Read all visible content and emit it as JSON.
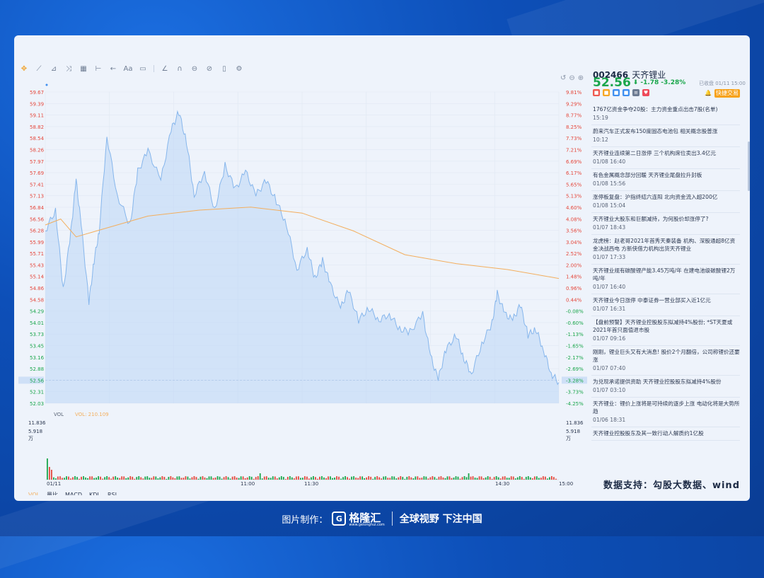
{
  "stock": {
    "code": "002466",
    "name": "天齐锂业",
    "price": "52.56",
    "change": "-1.78",
    "change_pct": "-3.28%",
    "status": "已收盘 01/11 15:00",
    "trade_button": "快捷交易"
  },
  "chart": {
    "price_ticks": [
      "59.67",
      "59.39",
      "59.11",
      "58.82",
      "58.54",
      "58.26",
      "57.97",
      "57.69",
      "57.41",
      "57.13",
      "56.84",
      "56.56",
      "56.28",
      "55.99",
      "55.71",
      "55.43",
      "55.14",
      "54.86",
      "54.58",
      "54.29",
      "54.01",
      "53.73",
      "53.45",
      "53.16",
      "52.88",
      "52.56",
      "52.31",
      "52.03"
    ],
    "pct_ticks": [
      "9.81%",
      "9.29%",
      "8.77%",
      "8.25%",
      "7.73%",
      "7.21%",
      "6.69%",
      "6.17%",
      "5.65%",
      "5.13%",
      "4.60%",
      "4.08%",
      "3.56%",
      "3.04%",
      "2.52%",
      "2.00%",
      "1.48%",
      "0.96%",
      "0.44%",
      "-0.08%",
      "-0.60%",
      "-1.13%",
      "-1.65%",
      "-2.17%",
      "-2.69%",
      "-3.28%",
      "-3.73%",
      "-4.25%"
    ],
    "time_labels": [
      "01/11",
      "11:00",
      "11:30",
      "14:30",
      "15:00"
    ],
    "vol_label": "VOL",
    "vol_value": "VOL: 210.109",
    "vol_ticks": [
      "11.836",
      "5.918",
      "万"
    ],
    "indicator_tabs": [
      "VOL",
      "量比",
      "MACD",
      "KDJ",
      "RSI"
    ],
    "colors": {
      "price_line": "#86b6ec",
      "avg_line": "#f3ae5d",
      "up": "#e5483c",
      "down": "#1aa64b",
      "area_fill": "#bcd6f6"
    }
  },
  "news": [
    {
      "title": "1767亿资金争夺20股：主力资金重点出击7股(名单)",
      "time": "15:19"
    },
    {
      "title": "蔚来汽车正式发布150度固态电池包 相关概念股普涨",
      "time": "10:12"
    },
    {
      "title": "天齐锂业连续第二日涨停 三个机构席位卖出3.4亿元",
      "time": "01/08 16:40"
    },
    {
      "title": "有色金属概念部分回暖 天齐锂业尾盘拉升封板",
      "time": "01/08 15:56"
    },
    {
      "title": "涨停板复盘：沪指终结六连阳 北向资金流入超200亿",
      "time": "01/08 15:04"
    },
    {
      "title": "天齐锂业大股东和巨额减持，为何股价却涨停了?",
      "time": "01/07 18:43"
    },
    {
      "title": "龙虎榜：赵老哥2021年首秀天秦装备 机构、深股通超8亿资金决战西电 方新侠借力机构出货天齐锂业",
      "time": "01/07 17:33"
    },
    {
      "title": "天齐锂业规有碳酸锂产能3.45万吨/年 在建电池级碳酸锂2万吨/年",
      "time": "01/07 16:40"
    },
    {
      "title": "天齐锂业今日涨停 中泰证券一营业部买入近1亿元",
      "time": "01/07 16:31"
    },
    {
      "title": "【盘前预警】天齐锂业控股股东拟减持4%股份; *ST天夏或2021年首只面值退市股",
      "time": "01/07 09:16"
    },
    {
      "title": "刚刚，锂业巨头又有大消息! 股价2个月翻倍，公司称锂价还要涨",
      "time": "01/07 07:40"
    },
    {
      "title": "为兑现承诺提供资助 天齐锂业控股股东拟减持4%股份",
      "time": "01/07 03:10"
    },
    {
      "title": "天齐锂业：锂价上涨将是可持续的逐步上涨 电动化将是大势所趋",
      "time": "01/06 18:31"
    },
    {
      "title": "天齐锂业控股股东及其一致行动人解质约1亿股",
      "time": ""
    }
  ],
  "source_text": "数据支持：勾股大数据、wind",
  "footer": {
    "made_by": "图片制作：",
    "logo_text": "格隆汇",
    "logo_sub": "www.gelonghui.com",
    "slogan": "全球视野 下注中国"
  }
}
